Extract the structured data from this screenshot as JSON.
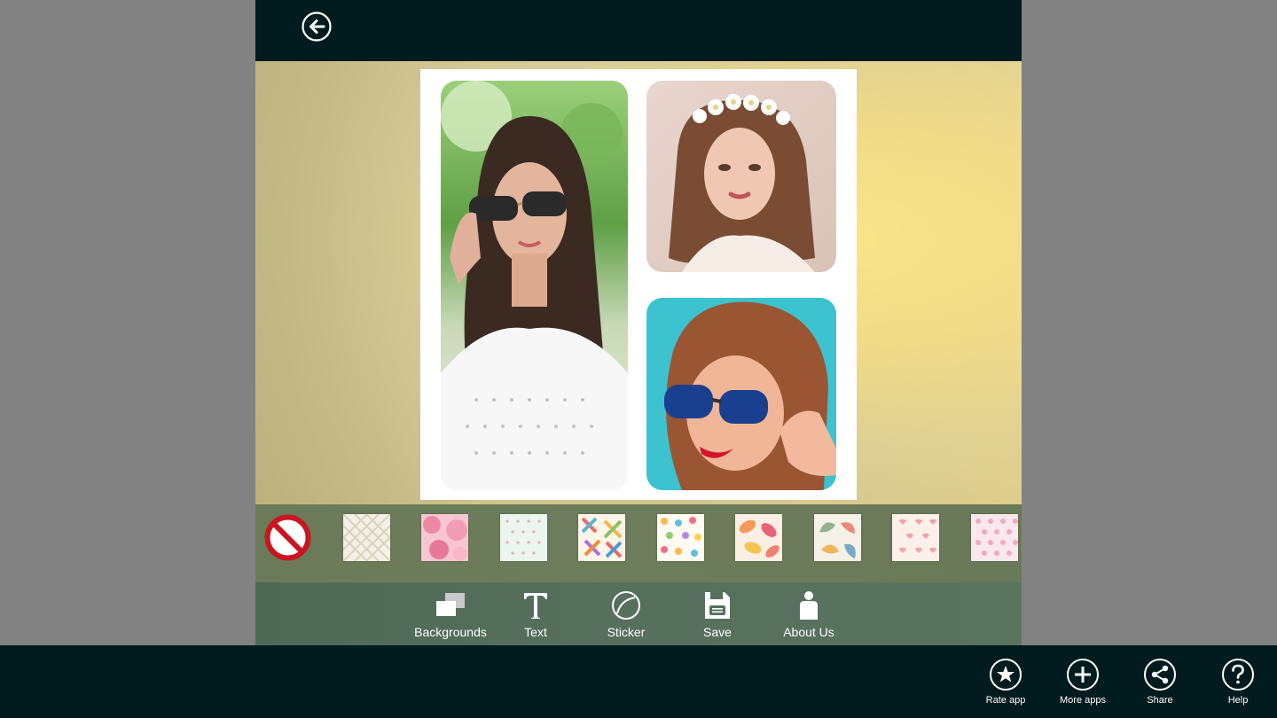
{
  "header": {
    "back_icon": "arrow-left-circle-icon"
  },
  "canvas": {
    "background_colors": [
      "#c6b985",
      "#f9e58a"
    ],
    "collage_background": "#ffffff",
    "photos": [
      {
        "name": "photo-left",
        "description_icon": "portrait-photo"
      },
      {
        "name": "photo-top-right",
        "description_icon": "portrait-photo"
      },
      {
        "name": "photo-bottom-right",
        "description_icon": "portrait-photo"
      }
    ]
  },
  "patterns": {
    "none_icon": "no-entry-icon",
    "swatches": [
      {
        "name": "plaid-beige",
        "colors": [
          "#f3f0e6",
          "#d9d3bd"
        ]
      },
      {
        "name": "pink-watercolor",
        "colors": [
          "#f7b7c8",
          "#e77f9c"
        ]
      },
      {
        "name": "mint-dots",
        "colors": [
          "#eaf5ee",
          "#f0a8b8"
        ]
      },
      {
        "name": "colorful-crosses",
        "colors": [
          "#fdf4e8",
          "#e66a6a"
        ]
      },
      {
        "name": "confetti-dots",
        "colors": [
          "#fffaf2",
          "#ffb84d"
        ]
      },
      {
        "name": "autumn-leaves",
        "colors": [
          "#fbeee3",
          "#f29a5c"
        ]
      },
      {
        "name": "paisley",
        "colors": [
          "#f6f1e6",
          "#8fb58a"
        ]
      },
      {
        "name": "hearts",
        "colors": [
          "#fdf0ea",
          "#f4a2a6"
        ]
      },
      {
        "name": "pink-polka",
        "colors": [
          "#fbe8ee",
          "#f1a9bd"
        ]
      }
    ]
  },
  "toolbar": {
    "items": [
      {
        "label": "Backgrounds",
        "icon": "layers-icon"
      },
      {
        "label": "Text",
        "icon": "text-icon"
      },
      {
        "label": "Sticker",
        "icon": "sticker-icon"
      },
      {
        "label": "Save",
        "icon": "save-icon"
      },
      {
        "label": "About Us",
        "icon": "person-icon"
      }
    ]
  },
  "appbar": {
    "items": [
      {
        "label": "Rate app",
        "icon": "star-icon"
      },
      {
        "label": "More apps",
        "icon": "plus-icon"
      },
      {
        "label": "Share",
        "icon": "share-icon"
      },
      {
        "label": "Help",
        "icon": "help-icon"
      }
    ]
  }
}
